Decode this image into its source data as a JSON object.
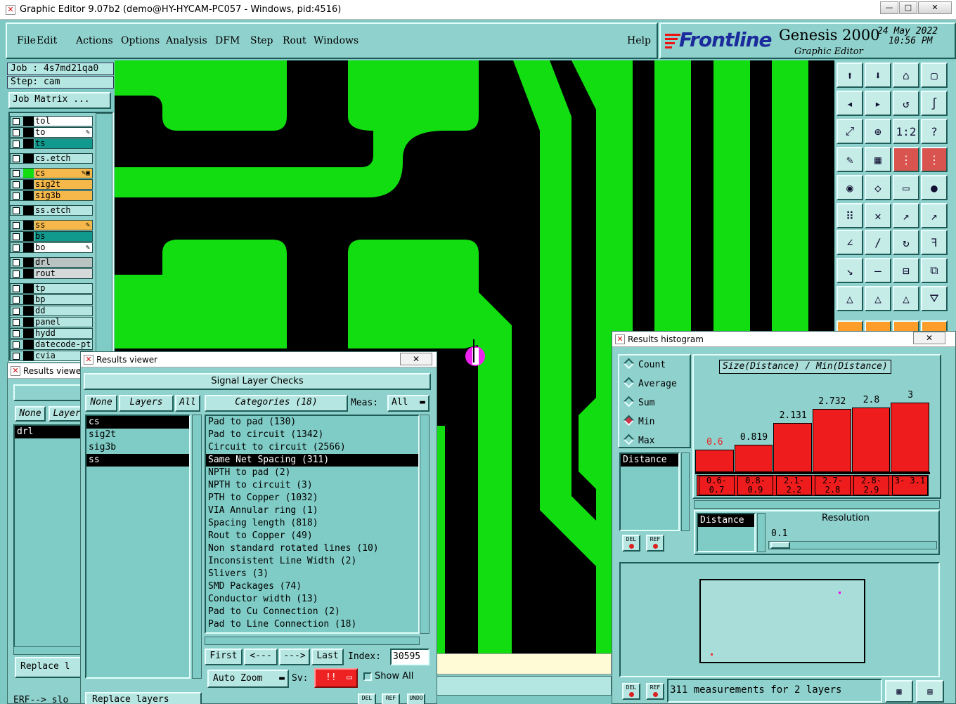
{
  "window": {
    "title": "Graphic Editor 9.07b2 (demo@HY-HYCAM-PC057 - Windows, pid:4516)",
    "minimize": "—",
    "maximize": "□",
    "close": "✕"
  },
  "menu": {
    "items": [
      "File",
      "Edit",
      "Actions",
      "Options",
      "Analysis",
      "DFM",
      "Step",
      "Rout",
      "Windows"
    ],
    "help": "Help"
  },
  "brand": {
    "logo": "Frontline",
    "product": "Genesis 2000",
    "subtitle": "Graphic Editor",
    "date": "24 May 2022",
    "time": "10:56 PM"
  },
  "job": {
    "job": "Job : 4s7md21qa0",
    "step": "Step: cam",
    "matrix_button": "Job Matrix ..."
  },
  "layers": [
    {
      "name": "tol",
      "color": "#ffffff",
      "edit": ""
    },
    {
      "name": "to",
      "color": "#ffffff",
      "edit": "✎"
    },
    {
      "name": "ts",
      "color": "#11998d",
      "edit": ""
    },
    {
      "name": "cs.etch",
      "color": "#b6e6e1",
      "edit": ""
    },
    {
      "name": "cs",
      "color": "#f6b84a",
      "edit": "✎▣"
    },
    {
      "name": "sig2t",
      "color": "#f6b84a",
      "edit": ""
    },
    {
      "name": "sig3b",
      "color": "#f6b84a",
      "edit": ""
    },
    {
      "name": "ss.etch",
      "color": "#b6e6e1",
      "edit": ""
    },
    {
      "name": "ss",
      "color": "#f6b84a",
      "edit": "✎"
    },
    {
      "name": "bs",
      "color": "#11998d",
      "edit": ""
    },
    {
      "name": "bo",
      "color": "#ffffff",
      "edit": "✎"
    },
    {
      "name": "drl",
      "color": "#b8c3c2",
      "edit": ""
    },
    {
      "name": "rout",
      "color": "#d6d9d9",
      "edit": ""
    },
    {
      "name": "tp",
      "color": "#b6e6e1",
      "edit": ""
    },
    {
      "name": "bp",
      "color": "#b6e6e1",
      "edit": ""
    },
    {
      "name": "dd",
      "color": "#b6e6e1",
      "edit": ""
    },
    {
      "name": "panel",
      "color": "#b6e6e1",
      "edit": ""
    },
    {
      "name": "hydd",
      "color": "#b6e6e1",
      "edit": ""
    },
    {
      "name": "datecode-pt",
      "color": "#b6e6e1",
      "edit": ""
    },
    {
      "name": "cvia",
      "color": "#b6e6e1",
      "edit": ""
    }
  ],
  "back_viewer": {
    "title": "Results viewer",
    "none": "None",
    "layers": "Layers",
    "item": "drl",
    "replace": "Replace l",
    "footer": "ERF--> slo"
  },
  "results_viewer": {
    "title": "Results viewer",
    "close": "✕",
    "heading": "Signal Layer Checks",
    "none": "None",
    "layers": "Layers",
    "all": "All",
    "layer_list": [
      "cs",
      "sig2t",
      "sig3b",
      "ss"
    ],
    "categories_label": "Categories (18)",
    "meas_label": "Meas:",
    "meas_value": "All",
    "categories": [
      "Pad to pad (130)",
      "Pad to circuit (1342)",
      "Circuit to circuit (2566)",
      "Same Net Spacing (311)",
      "NPTH to pad (2)",
      "NPTH to circuit (3)",
      "PTH to Copper (1032)",
      "VIA Annular ring (1)",
      "Spacing length (818)",
      "Rout to Copper (49)",
      "Non standard rotated lines (10)",
      "Inconsistent Line Width (2)",
      "Slivers (3)",
      "SMD Packages (74)",
      "Conductor width (13)",
      "Pad to Cu Connection (2)",
      "Pad to Line Connection (18)"
    ],
    "first": "First",
    "prev": "<---",
    "next": "--->",
    "last": "Last",
    "index_label": "Index:",
    "index_value": "30595",
    "auto_zoom": "Auto Zoom",
    "sv_label": "Sv:",
    "sv_value": "!!",
    "show_all": "Show All",
    "replace": "Replace layers",
    "del": "DEL",
    "ref": "REF",
    "undo": "UNDO"
  },
  "histogram": {
    "title": "Results histogram",
    "close": "✕",
    "modes": [
      "Count",
      "Average",
      "Sum",
      "Min",
      "Max"
    ],
    "selected_mode": "Min",
    "field": "Distance",
    "resolution_label": "Resolution",
    "resolution_value": "0.1",
    "del": "DEL",
    "ref": "REF",
    "status": "311 measurements for 2 layers"
  },
  "chart_data": {
    "type": "bar",
    "title": "Size(Distance) / Min(Distance)",
    "categories": [
      "0.6- 0.7",
      "0.8- 0.9",
      "2.1- 2.2",
      "2.7- 2.8",
      "2.8- 2.9",
      "3- 3.1"
    ],
    "values": [
      0.6,
      0.819,
      2.131,
      2.732,
      2.8,
      3
    ],
    "labels": [
      "0.6",
      "0.819",
      "2.131",
      "2.732",
      "2.8",
      "3"
    ],
    "ylim": [
      0,
      3
    ],
    "xlabel": "",
    "ylabel": "",
    "bar_color": "#ee1c1c",
    "first_label_color": "#ee1c1c"
  },
  "colors": {
    "copper": "#11dd11",
    "board": "#000000",
    "marker": "#ee22ee",
    "panel": "#8fd1cc"
  }
}
